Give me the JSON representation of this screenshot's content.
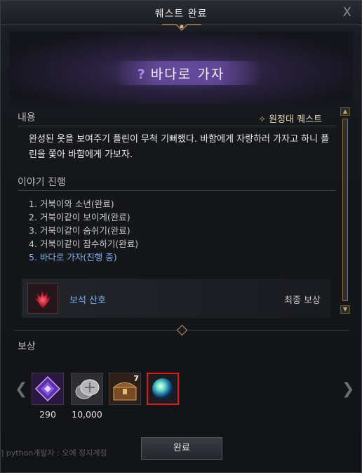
{
  "window": {
    "title": "퀘스트 완료",
    "close_label": "X"
  },
  "quest": {
    "name": "바다로 가자",
    "type_label": "원정대 퀘스트",
    "content_header": "내용",
    "description": "완성된 옷을 보여주기 플린이 무척 기뻐했다. 바함에게 자랑하러 가자고 하니 플린을 쫓아 바함에게 가보자.",
    "story_header": "이야기 진행",
    "steps": [
      {
        "text": "1. 거북이와 소년(완료)"
      },
      {
        "text": "2. 거북이같이 보이게(완료)"
      },
      {
        "text": "3. 거북이같이 숨쉬기(완료)"
      },
      {
        "text": "4. 거북이같이 잠수하기(완료)"
      },
      {
        "text": "5. 바다로 가자(진행 중)"
      }
    ]
  },
  "final_reward": {
    "name": "보석 산호",
    "label": "최종 보상"
  },
  "rewards": {
    "header": "보상",
    "items": [
      {
        "icon": "purple-crystal-icon",
        "quantity": "290"
      },
      {
        "icon": "silver-coin-icon",
        "quantity": "10,000"
      },
      {
        "icon": "treasure-chest-icon",
        "stack": "7"
      },
      {
        "icon": "blue-orb-icon",
        "selected": true
      }
    ]
  },
  "complete_button": "완료",
  "chat_bar": "] python개발자 : 오예 정지계정"
}
